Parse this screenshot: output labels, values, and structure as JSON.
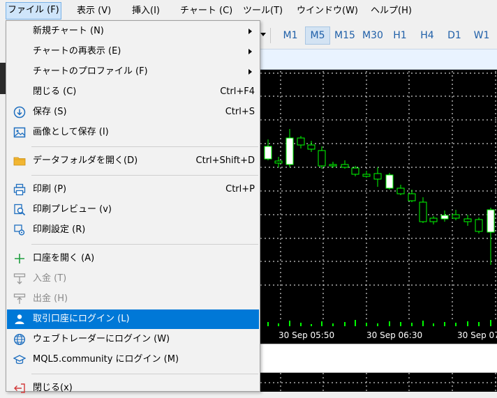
{
  "menubar": {
    "items": [
      {
        "label": "ファイル (F)",
        "active": true
      },
      {
        "label": "表示 (V)"
      },
      {
        "label": "挿入(I)"
      },
      {
        "label": "チャート (C)"
      },
      {
        "label": "ツール(T)"
      },
      {
        "label": "ウインドウ(W)"
      },
      {
        "label": "ヘルプ(H)"
      }
    ]
  },
  "timeframes": {
    "items": [
      "M1",
      "M5",
      "M15",
      "M30",
      "H1",
      "H4",
      "D1",
      "W1"
    ],
    "selected": "M5"
  },
  "file_menu": {
    "items": [
      {
        "label": "新規チャート (N)",
        "submenu": true
      },
      {
        "label": "チャートの再表示 (E)",
        "submenu": true
      },
      {
        "label": "チャートのプロファイル (F)",
        "submenu": true
      },
      {
        "label": "閉じる (C)",
        "shortcut": "Ctrl+F4"
      },
      {
        "label": "保存 (S)",
        "shortcut": "Ctrl+S",
        "icon": "save-icon"
      },
      {
        "label": "画像として保存 (I)",
        "icon": "image-icon"
      },
      {
        "label": "データフォルダを開く(D)",
        "shortcut": "Ctrl+Shift+D",
        "icon": "folder-icon"
      },
      {
        "label": "印刷 (P)",
        "shortcut": "Ctrl+P",
        "icon": "printer-icon"
      },
      {
        "label": "印刷プレビュー (v)",
        "icon": "print-preview-icon"
      },
      {
        "label": "印刷設定 (R)",
        "icon": "print-settings-icon"
      },
      {
        "label": "口座を開く (A)",
        "icon": "plus-icon"
      },
      {
        "label": "入金 (T)",
        "icon": "deposit-icon",
        "disabled": true
      },
      {
        "label": "出金 (H)",
        "icon": "withdraw-icon",
        "disabled": true
      },
      {
        "label": "取引口座にログイン (L)",
        "icon": "user-icon",
        "highlighted": true
      },
      {
        "label": "ウェブトレーダーにログイン (W)",
        "icon": "globe-icon"
      },
      {
        "label": "MQL5.community にログイン (M)",
        "icon": "graduation-cap-icon"
      },
      {
        "label": "閉じる(x)",
        "icon": "exit-icon"
      }
    ]
  },
  "chart": {
    "time_labels": [
      "30 Sep 05:50",
      "30 Sep 06:30",
      "30 Sep 07"
    ],
    "colors": {
      "background": "#000000",
      "candle": "#00ff00",
      "bull_body": "#ffffff",
      "grid": "#ffffff"
    }
  }
}
